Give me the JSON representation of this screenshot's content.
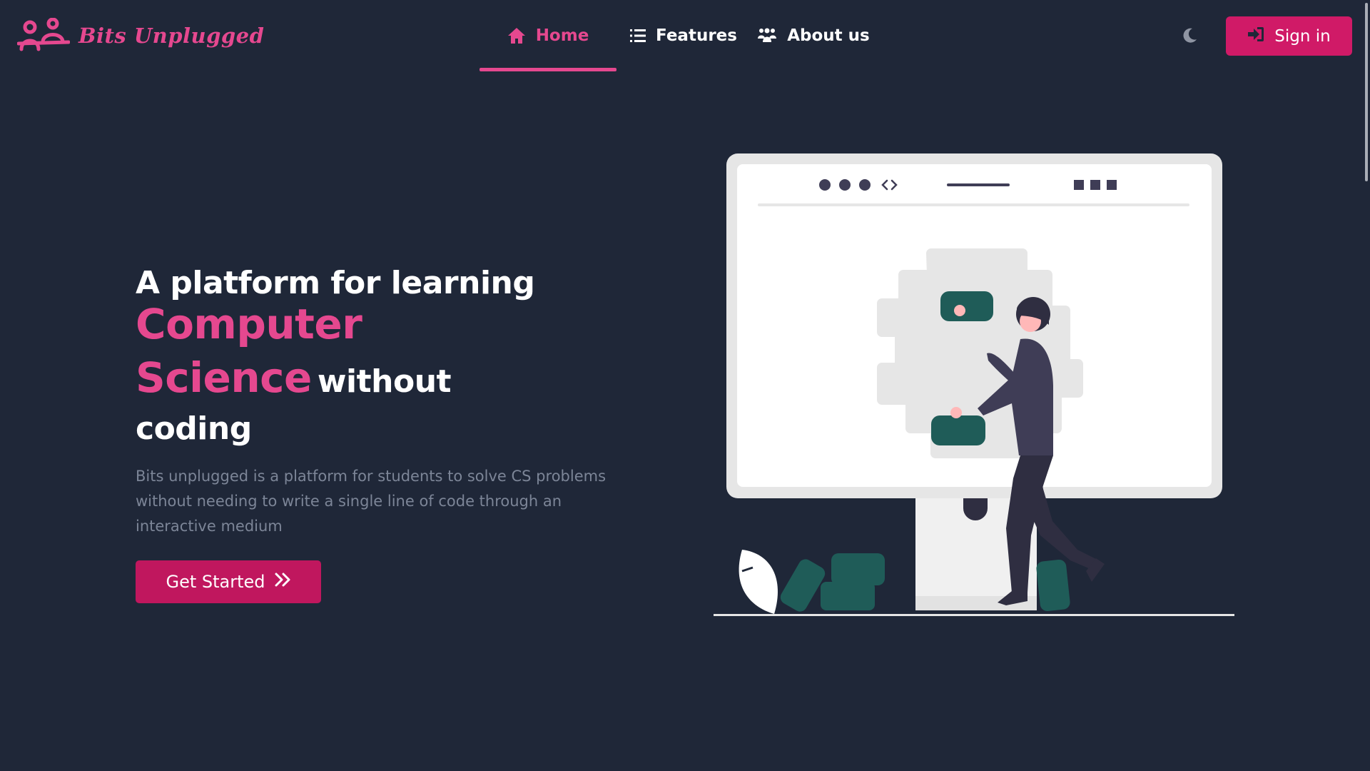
{
  "brand": {
    "name": "Bits Unplugged",
    "color": "#e5488f"
  },
  "nav": {
    "items": [
      {
        "label": "Home",
        "icon": "home-icon",
        "active": true
      },
      {
        "label": "Features",
        "icon": "list-icon",
        "active": false
      },
      {
        "label": "About us",
        "icon": "users-icon",
        "active": false
      }
    ]
  },
  "theme_toggle": {
    "icon": "moon-icon"
  },
  "signin": {
    "label": "Sign in",
    "icon": "sign-in-icon",
    "color": "#d01a67"
  },
  "hero": {
    "line1": "A platform for learning",
    "accent": "Computer Science",
    "rest": "without",
    "line3": "coding",
    "description": "Bits unplugged is a platform for students to solve CS problems without needing to write a single line of code through an interactive medium",
    "cta_label": "Get Started",
    "cta_icon": "double-chevron-right-icon"
  },
  "colors": {
    "background": "#1f2738",
    "accent": "#e5488f",
    "button": "#c0175e",
    "muted_text": "#7c8597"
  }
}
